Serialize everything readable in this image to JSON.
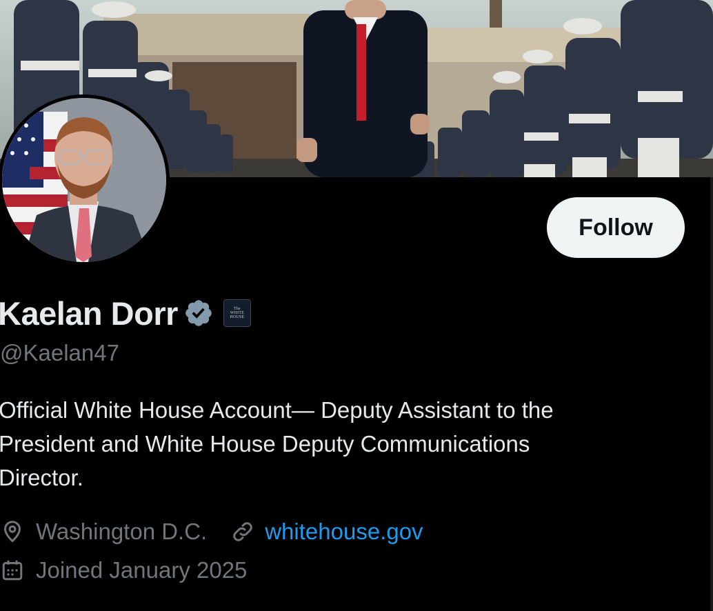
{
  "profile": {
    "display_name": "Kaelan Dorr",
    "verified_badge": "verified-check-icon",
    "affiliation_badge": {
      "icon": "white-house-logo",
      "lines": [
        "The",
        "WHITE",
        "HOUSE"
      ]
    },
    "handle": "@Kaelan47",
    "bio": "Official White House Account— Deputy Assistant to the\nPresident and White House Deputy Communications\nDirector.",
    "location": "Washington D.C.",
    "website": "whitehouse.gov",
    "joined": "Joined January 2025"
  },
  "actions": {
    "follow_label": "Follow"
  },
  "icons": {
    "location": "location-pin-icon",
    "website": "link-icon",
    "joined": "calendar-icon"
  },
  "colors": {
    "background": "#000000",
    "text_primary": "#e7e9ea",
    "text_secondary": "#71767b",
    "link": "#1d9bf0",
    "verified": "#829aab",
    "follow_bg": "#eff3f4"
  }
}
